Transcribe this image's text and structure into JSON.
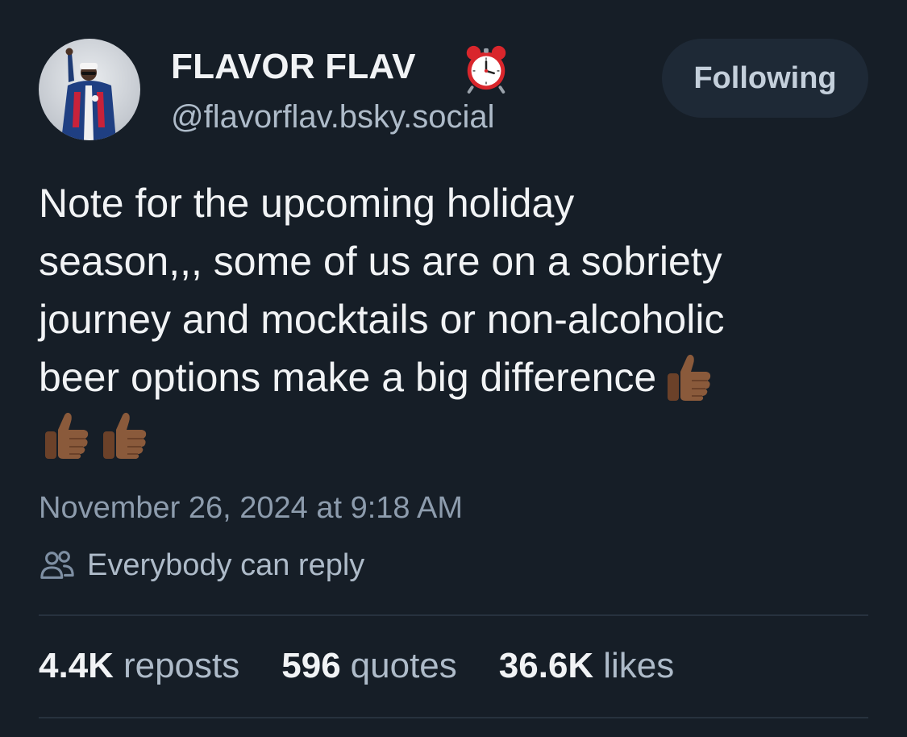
{
  "author": {
    "display_name": "FLAVOR FLAV",
    "display_name_emoji": "alarm-clock-icon",
    "handle": "@flavorflav.bsky.social",
    "avatar": "avatar-photo"
  },
  "follow_button": {
    "label": "Following"
  },
  "post": {
    "text_lines": [
      "Note for the upcoming holiday",
      "season,,, some of us are on a sobriety",
      "journey and mocktails or non-alcoholic",
      "beer options make a big difference"
    ],
    "trailing_emoji": [
      "thumbs-up-icon",
      "thumbs-up-icon",
      "thumbs-up-icon"
    ],
    "timestamp": "November 26, 2024 at 9:18 AM"
  },
  "reply_setting": {
    "icon": "people-icon",
    "label": "Everybody can reply"
  },
  "stats": [
    {
      "count": "4.4K",
      "label": "reposts"
    },
    {
      "count": "596",
      "label": "quotes"
    },
    {
      "count": "36.6K",
      "label": "likes"
    }
  ],
  "colors": {
    "background": "#161e27",
    "primary_text": "#f1f3f5",
    "secondary_text": "#aebbc9",
    "muted_text": "#8d9cad",
    "button_bg": "#1e2936",
    "divider": "#27323e"
  }
}
